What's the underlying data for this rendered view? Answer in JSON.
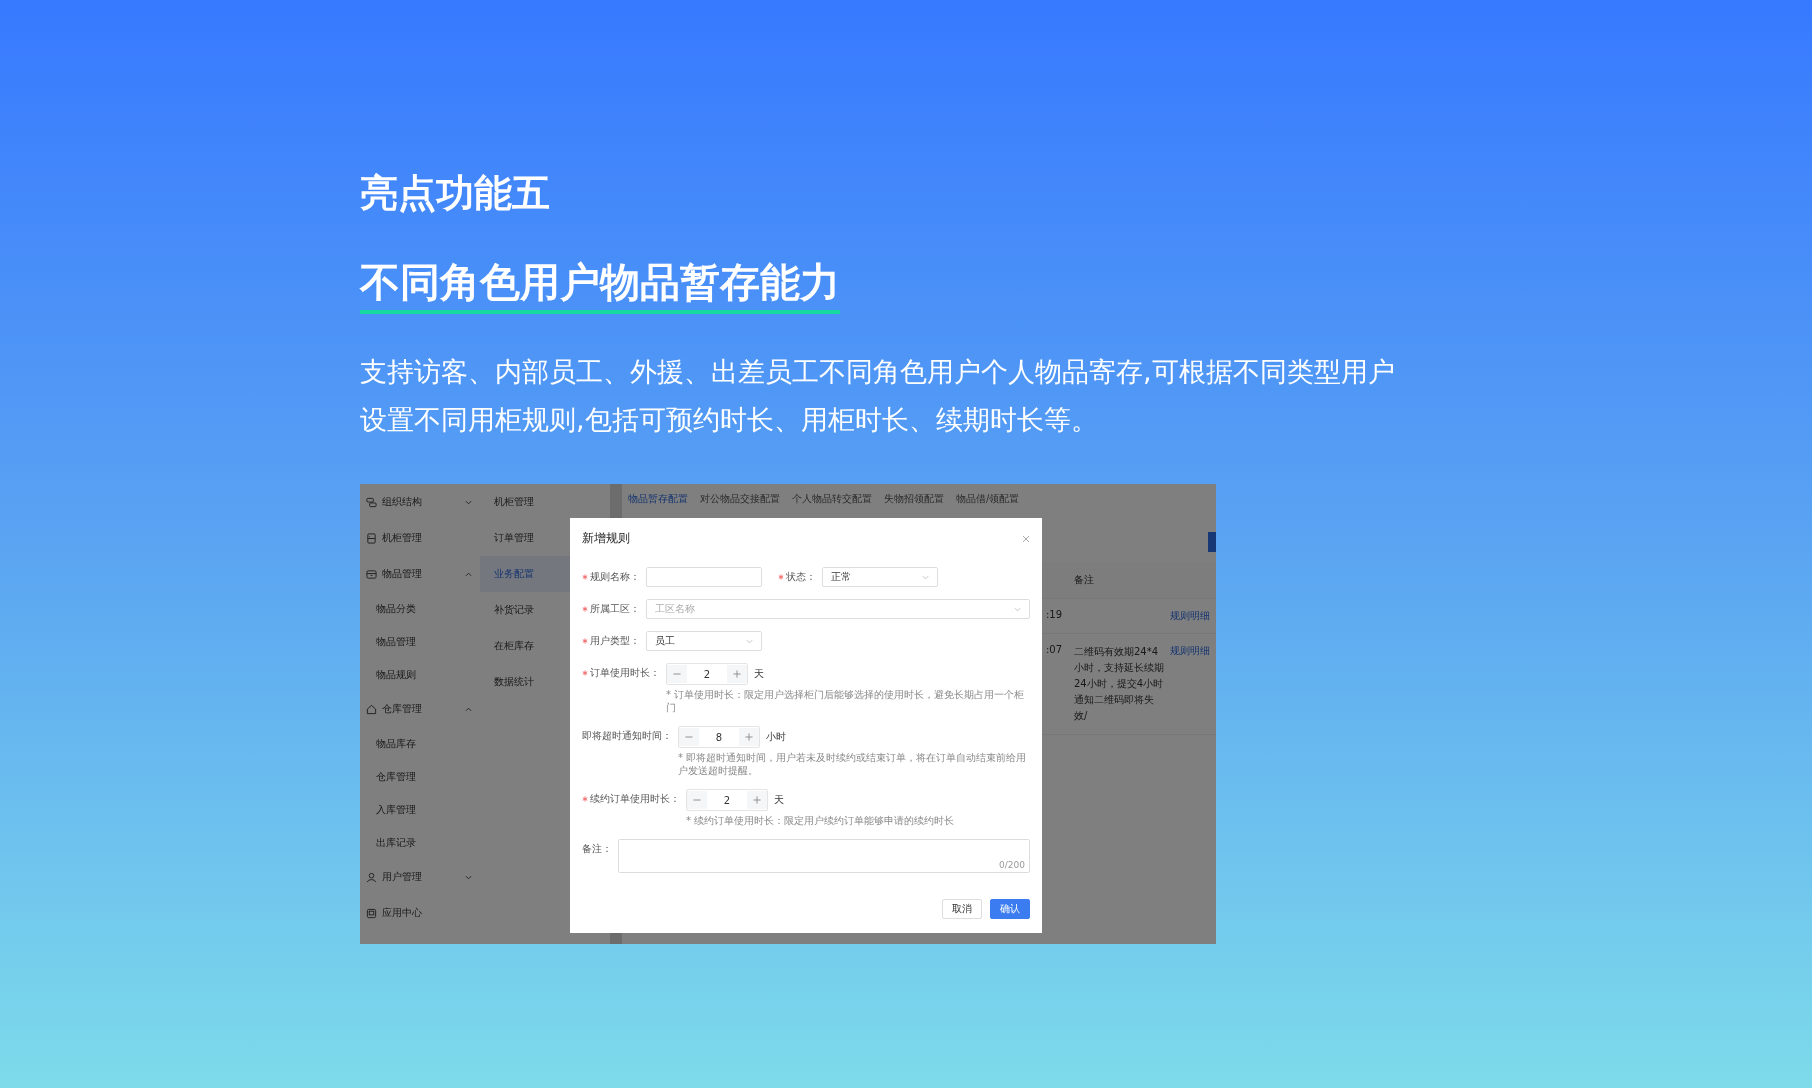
{
  "heading": "亮点功能五",
  "subheading": "不同角色用户物品暂存能力",
  "description": "支持访客、内部员工、外援、出差员工不同角色用户个人物品寄存,可根据不同类型用户设置不同用柜规则,包括可预约时长、用柜时长、续期时长等。",
  "app": {
    "sidebar": {
      "items": [
        {
          "kind": "group",
          "label": "组织结构",
          "expanded": false
        },
        {
          "kind": "link",
          "label": "机柜管理"
        },
        {
          "kind": "group",
          "label": "物品管理",
          "expanded": true
        },
        {
          "kind": "child",
          "label": "物品分类"
        },
        {
          "kind": "child",
          "label": "物品管理"
        },
        {
          "kind": "child",
          "label": "物品规则"
        },
        {
          "kind": "group",
          "label": "仓库管理",
          "expanded": true
        },
        {
          "kind": "child",
          "label": "物品库存"
        },
        {
          "kind": "child",
          "label": "仓库管理"
        },
        {
          "kind": "child",
          "label": "入库管理"
        },
        {
          "kind": "child",
          "label": "出库记录"
        },
        {
          "kind": "group",
          "label": "用户管理",
          "expanded": false
        },
        {
          "kind": "link",
          "label": "应用中心"
        }
      ]
    },
    "submenu": {
      "items": [
        {
          "label": "机柜管理",
          "selected": false
        },
        {
          "label": "订单管理",
          "selected": false
        },
        {
          "label": "业务配置",
          "selected": true
        },
        {
          "label": "补货记录",
          "selected": false
        },
        {
          "label": "在柜库存",
          "selected": false
        },
        {
          "label": "数据统计",
          "selected": false
        }
      ]
    },
    "tabs": [
      {
        "label": "物品暂存配置",
        "selected": true
      },
      {
        "label": "对公物品交接配置",
        "selected": false
      },
      {
        "label": "个人物品转交配置",
        "selected": false
      },
      {
        "label": "失物招领配置",
        "selected": false
      },
      {
        "label": "物品借/领配置",
        "selected": false
      }
    ],
    "table": {
      "columns": [
        "备注"
      ],
      "rows": [
        {
          "time": ":19",
          "link": "规则明细"
        },
        {
          "time": ":07",
          "remark": "二维码有效期24*4小时，支持延长续期24小时，提交4小时通知二维码即将失效/",
          "link": "规则明细"
        }
      ]
    },
    "dialog": {
      "title": "新增规则",
      "rows": [
        {
          "fields": [
            {
              "kind": "input",
              "label": "规则名称：",
              "required": true
            },
            {
              "kind": "select",
              "label": "状态：",
              "required": true,
              "value": "正常"
            }
          ]
        },
        {
          "fields": [
            {
              "kind": "select",
              "label": "所属工区：",
              "required": true,
              "placeholder": "工区名称",
              "wide": true
            }
          ]
        },
        {
          "fields": [
            {
              "kind": "select",
              "label": "用户类型：",
              "required": true,
              "value": "员工"
            }
          ]
        },
        {
          "fields": [
            {
              "kind": "stepper",
              "label": "订单使用时长：",
              "required": true,
              "value": "2",
              "unit": "天",
              "hint": "* 订单使用时长：限定用户选择柜门后能够选择的使用时长，避免长期占用一个柜门"
            }
          ]
        },
        {
          "fields": [
            {
              "kind": "stepper",
              "label": "即将超时通知时间：",
              "required": false,
              "value": "8",
              "unit": "小时",
              "hint": "* 即将超时通知时间，用户若未及时续约或结束订单，将在订单自动结束前给用户发送超时提醒。"
            }
          ]
        },
        {
          "fields": [
            {
              "kind": "stepper",
              "label": "续约订单使用时长：",
              "required": true,
              "value": "2",
              "unit": "天",
              "hint": "* 续约订单使用时长：限定用户续约订单能够申请的续约时长"
            }
          ]
        },
        {
          "fields": [
            {
              "kind": "textarea",
              "label": "备注：",
              "required": false,
              "counter": "0/200"
            }
          ]
        }
      ],
      "buttons": [
        {
          "label": "取消",
          "kind": "default"
        },
        {
          "label": "确认",
          "kind": "primary"
        }
      ]
    }
  }
}
